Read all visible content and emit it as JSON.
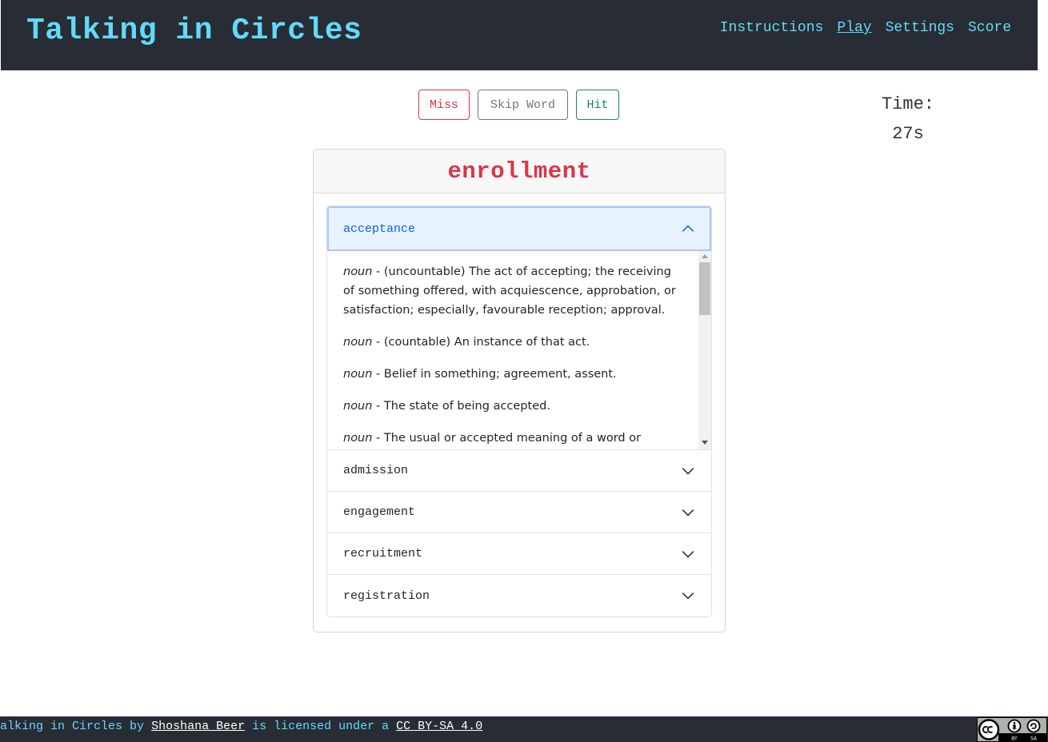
{
  "header": {
    "title": "Talking in Circles",
    "nav": [
      "Instructions",
      "Play",
      "Settings",
      "Score"
    ],
    "active_nav": "Play"
  },
  "controls": {
    "miss_label": "Miss",
    "skip_label": "Skip Word",
    "hit_label": "Hit"
  },
  "timer": {
    "label": "Time:",
    "value": "27s"
  },
  "card": {
    "target_word": "enrollment",
    "items": [
      {
        "word": "acceptance",
        "expanded": true,
        "definitions": [
          {
            "pos": "noun",
            "text": " - (uncountable) The act of accepting; the receiving of something offered, with acquiescence, approbation, or satisfaction; especially, favourable reception; approval."
          },
          {
            "pos": "noun",
            "text": " - (countable) An instance of that act."
          },
          {
            "pos": "noun",
            "text": " - Belief in something; agreement, assent."
          },
          {
            "pos": "noun",
            "text": " - The state of being accepted."
          },
          {
            "pos": "noun",
            "text": " - The usual or accepted meaning of a word or"
          }
        ]
      },
      {
        "word": "admission",
        "expanded": false
      },
      {
        "word": "engagement",
        "expanded": false
      },
      {
        "word": "recruitment",
        "expanded": false
      },
      {
        "word": "registration",
        "expanded": false
      }
    ]
  },
  "footer": {
    "work_title": "Talking in Circles",
    "by": "by",
    "author": "Shoshana Beer",
    "licensed": "is licensed under a",
    "license": "CC BY-SA 4.0",
    "badge_icons": [
      "cc-icon",
      "by-icon",
      "sa-icon"
    ],
    "badge_labels": [
      "BY",
      "SA"
    ]
  },
  "colors": {
    "header_bg": "#282c34",
    "accent": "#61dafb",
    "miss": "#dc3545",
    "skip": "#6c757d",
    "hit": "#198754",
    "active_item": "#0c63e4"
  }
}
